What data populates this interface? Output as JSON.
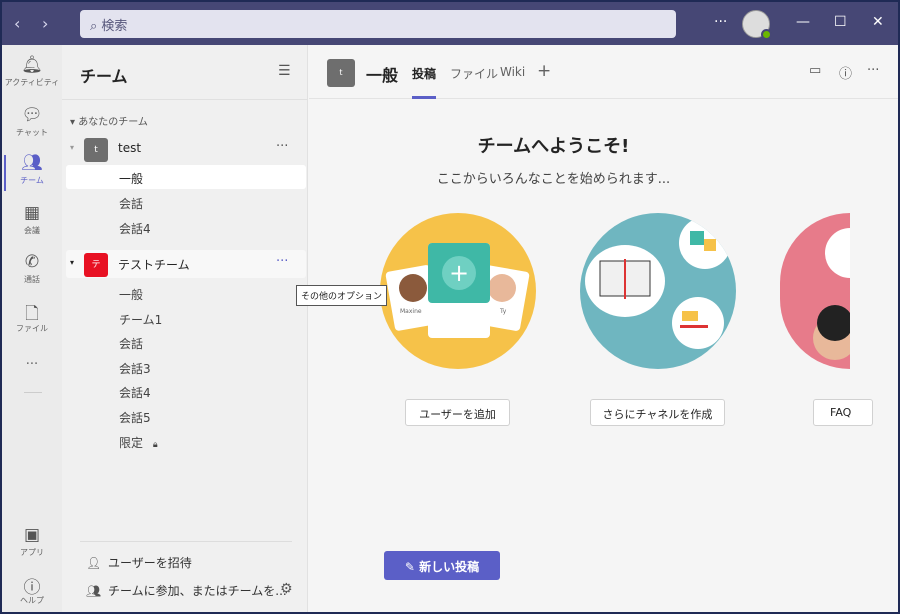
{
  "topbar": {
    "search_placeholder": "検索",
    "back": "‹",
    "forward": "›",
    "more": "···",
    "minimize": "—",
    "maximize": "☐",
    "close": "✕"
  },
  "rail": [
    {
      "label": "アクティビティ"
    },
    {
      "label": "チャット"
    },
    {
      "label": "チーム"
    },
    {
      "label": "会議"
    },
    {
      "label": "通話"
    },
    {
      "label": "ファイル"
    },
    {
      "label": "アプリ"
    },
    {
      "label": "ヘルプ"
    }
  ],
  "rail_more": "···",
  "teams_panel": {
    "title": "チーム",
    "section": "あなたのチーム",
    "teams": [
      {
        "name": "test",
        "initial": "t",
        "color": "#6e6e6e",
        "channels": [
          "一般",
          "会話",
          "会話4"
        ]
      },
      {
        "name": "テストチーム",
        "initial": "テ",
        "color": "#e81123",
        "channels": [
          "一般",
          "チーム1",
          "会話",
          "会話3",
          "会話4",
          "会話5",
          "限定"
        ]
      }
    ],
    "more_tooltip": "その他のオプション",
    "invite": "ユーザーを招待",
    "join": "チームに参加、またはチームを..."
  },
  "channel_header": {
    "initial": "t",
    "title": "一般",
    "tabs": [
      "投稿",
      "ファイル",
      "Wiki"
    ],
    "add": "+"
  },
  "welcome": {
    "title": "チームへようこそ!",
    "subtitle": "ここからいろんなことを始められます...",
    "actions": [
      "ユーザーを追加",
      "さらにチャネルを作成",
      "FAQ"
    ],
    "card_names": [
      "Maxine",
      "Ty"
    ]
  },
  "new_post": "新しい投稿",
  "colors": {
    "accent": "#5b5fc7",
    "titlebar": "#464775"
  }
}
